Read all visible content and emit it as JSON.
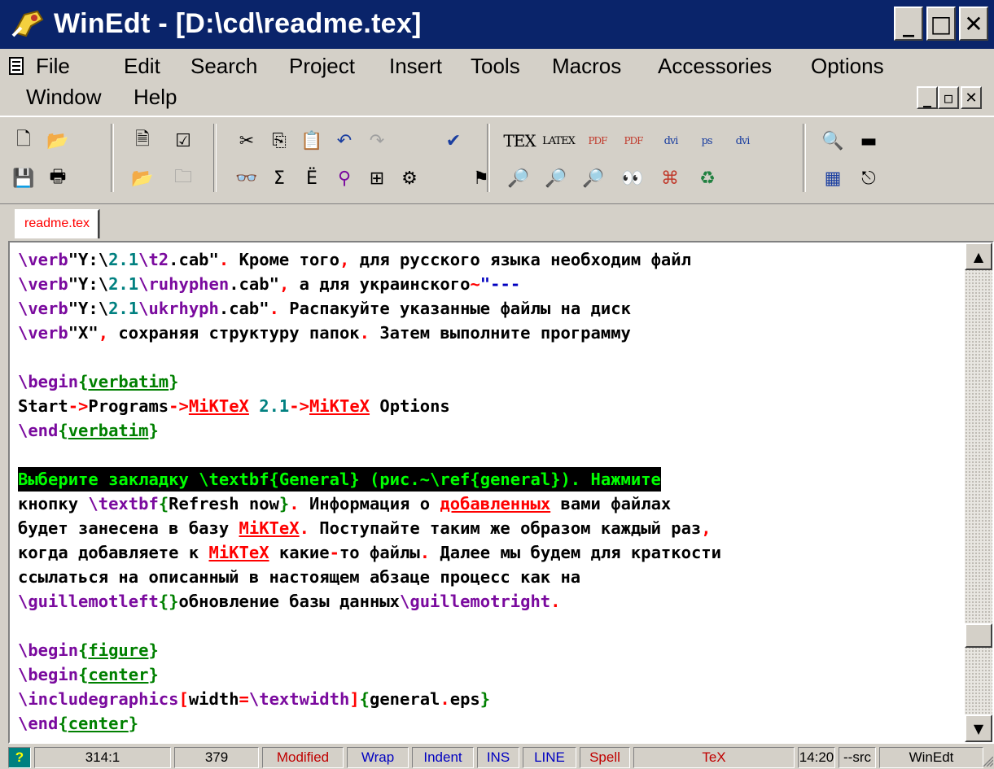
{
  "window": {
    "title": "WinEdt  - [D:\\cd\\readme.tex]",
    "min": "_",
    "max": "□",
    "close": "✕"
  },
  "menu": {
    "row1": [
      "File",
      "Edit",
      "Search",
      "Project",
      "Insert",
      "Tools",
      "Macros",
      "Accessories",
      "Options"
    ],
    "row2": [
      "Window",
      "Help"
    ]
  },
  "toolbar": {
    "row1": [
      {
        "icon": "new-file-icon",
        "glyph": "🗋"
      },
      {
        "icon": "open-file-icon",
        "glyph": "📂"
      },
      {
        "icon": "document-icon",
        "glyph": "🗎"
      },
      {
        "icon": "checklist-icon",
        "glyph": "☑"
      },
      {
        "icon": "cut-icon",
        "glyph": "✂"
      },
      {
        "icon": "copy-icon",
        "glyph": "⎘"
      },
      {
        "icon": "paste-icon",
        "glyph": "📋"
      },
      {
        "icon": "undo-icon",
        "glyph": "↶"
      },
      {
        "icon": "redo-icon",
        "glyph": "↷"
      },
      {
        "icon": "spellcheck-icon",
        "glyph": "✔"
      },
      {
        "icon": "tex-icon",
        "text": "TEX"
      },
      {
        "icon": "latex-icon",
        "text": "LATEX"
      },
      {
        "icon": "pdftex-icon",
        "text": "PDF"
      },
      {
        "icon": "pdflatex-icon",
        "text": "PDF"
      },
      {
        "icon": "dvips-icon",
        "text": "dvi"
      },
      {
        "icon": "ps2pdf-icon",
        "text": "ps"
      },
      {
        "icon": "dvipdf-icon",
        "text": "dvi"
      },
      {
        "icon": "search-icon",
        "glyph": "🔍"
      },
      {
        "icon": "console-icon",
        "glyph": "▬"
      }
    ],
    "row2": [
      {
        "icon": "save-icon",
        "glyph": "💾"
      },
      {
        "icon": "print-icon",
        "glyph": "🖶"
      },
      {
        "icon": "open-project-icon",
        "glyph": "📂"
      },
      {
        "icon": "close-project-icon",
        "glyph": "🗀"
      },
      {
        "icon": "binoculars-icon",
        "glyph": "👓"
      },
      {
        "icon": "sum-icon",
        "glyph": "Σ"
      },
      {
        "icon": "umlaut-icon",
        "glyph": "Ë"
      },
      {
        "icon": "filter-icon",
        "glyph": "⚲"
      },
      {
        "icon": "tree-icon",
        "glyph": "⊞"
      },
      {
        "icon": "macro-icon",
        "glyph": "⚙"
      },
      {
        "icon": "compile-icon",
        "glyph": "⚑"
      },
      {
        "icon": "log-icon",
        "glyph": "🔎"
      },
      {
        "icon": "dvi-preview-icon",
        "glyph": "🔎"
      },
      {
        "icon": "dvi-search-icon",
        "glyph": "🔎"
      },
      {
        "icon": "viewer-icon",
        "glyph": "👀"
      },
      {
        "icon": "acrobat-icon",
        "glyph": "⌘"
      },
      {
        "icon": "cleanup-icon",
        "glyph": "♻"
      },
      {
        "icon": "calculator-icon",
        "glyph": "▦"
      },
      {
        "icon": "exit-icon",
        "glyph": "⎋"
      }
    ]
  },
  "tab": {
    "label": "readme.tex"
  },
  "editor": {
    "lines": [
      [
        [
          "\\verb",
          "cmd"
        ],
        [
          "\"Y:\\",
          ""
        ],
        [
          "2.1",
          "num"
        ],
        [
          "\\t2",
          "cmd"
        ],
        [
          ".cab\"",
          ""
        ],
        [
          ". ",
          "sym"
        ],
        [
          "Кроме того",
          ""
        ],
        [
          ",",
          "sym"
        ],
        [
          " для русского языка необходим файл",
          ""
        ]
      ],
      [
        [
          "\\verb",
          "cmd"
        ],
        [
          "\"Y:\\",
          ""
        ],
        [
          "2.1",
          "num"
        ],
        [
          "\\ruhyphen",
          "cmd"
        ],
        [
          ".cab\"",
          ""
        ],
        [
          ",",
          "sym"
        ],
        [
          " а для украинского",
          ""
        ],
        [
          "~",
          "sym"
        ],
        [
          "\"---",
          "blue"
        ]
      ],
      [
        [
          "\\verb",
          "cmd"
        ],
        [
          "\"Y:\\",
          ""
        ],
        [
          "2.1",
          "num"
        ],
        [
          "\\ukrhyph",
          "cmd"
        ],
        [
          ".cab\"",
          ""
        ],
        [
          ".",
          "sym"
        ],
        [
          " Распакуйте указанные файлы на диск",
          ""
        ]
      ],
      [
        [
          "\\verb",
          "cmd"
        ],
        [
          "\"X\"",
          ""
        ],
        [
          ",",
          "sym"
        ],
        [
          " сохраняя структуру папок",
          ""
        ],
        [
          ".",
          "sym"
        ],
        [
          " Затем выполните программу",
          ""
        ]
      ],
      [],
      [
        [
          "\\begin",
          "cmd"
        ],
        [
          "{",
          "brace"
        ],
        [
          "verbatim",
          "arg"
        ],
        [
          "}",
          "brace"
        ]
      ],
      [
        [
          "Start",
          ""
        ],
        [
          "->",
          "sym"
        ],
        [
          "Programs",
          ""
        ],
        [
          "->",
          "sym"
        ],
        [
          "MiKTeX",
          "kw"
        ],
        [
          " ",
          ""
        ],
        [
          "2.1",
          "num"
        ],
        [
          "->",
          "sym"
        ],
        [
          "MiKTeX",
          "kw"
        ],
        [
          " Options",
          ""
        ]
      ],
      [
        [
          "\\end",
          "cmd"
        ],
        [
          "{",
          "brace"
        ],
        [
          "verbatim",
          "arg"
        ],
        [
          "}",
          "brace"
        ]
      ],
      [],
      [
        [
          "Выберите закладку \\textbf{General} (рис.~\\ref{general}). Нажмите",
          "sel"
        ]
      ],
      [
        [
          "кнопку ",
          ""
        ],
        [
          "\\textbf",
          "cmd"
        ],
        [
          "{",
          "brace"
        ],
        [
          "Refresh now",
          ""
        ],
        [
          "}",
          "brace"
        ],
        [
          ".",
          "sym"
        ],
        [
          " Информация о ",
          ""
        ],
        [
          "добавленных",
          "kw"
        ],
        [
          " вами файлах",
          ""
        ]
      ],
      [
        [
          "будет занесена в базу ",
          ""
        ],
        [
          "MiKTeX",
          "kw"
        ],
        [
          ".",
          "sym"
        ],
        [
          " Поступайте таким же образом каждый раз",
          ""
        ],
        [
          ",",
          "sym"
        ]
      ],
      [
        [
          "когда добавляете к ",
          ""
        ],
        [
          "MiKTeX",
          "kw"
        ],
        [
          " какие",
          ""
        ],
        [
          "-",
          "sym"
        ],
        [
          "то файлы",
          ""
        ],
        [
          ".",
          "sym"
        ],
        [
          " Далее мы будем для краткости",
          ""
        ]
      ],
      [
        [
          "ссылаться на описанный в настоящем абзаце процесс как на",
          ""
        ]
      ],
      [
        [
          "\\guillemotleft",
          "cmd"
        ],
        [
          "{}",
          "brace"
        ],
        [
          "обновление базы данных",
          ""
        ],
        [
          "\\guillemotright",
          "cmd"
        ],
        [
          ".",
          "sym"
        ]
      ],
      [],
      [
        [
          "\\begin",
          "cmd"
        ],
        [
          "{",
          "brace"
        ],
        [
          "figure",
          "arg"
        ],
        [
          "}",
          "brace"
        ]
      ],
      [
        [
          "\\begin",
          "cmd"
        ],
        [
          "{",
          "brace"
        ],
        [
          "center",
          "arg"
        ],
        [
          "}",
          "brace"
        ]
      ],
      [
        [
          "\\includegraphics",
          "cmd"
        ],
        [
          "[",
          "sym"
        ],
        [
          "width",
          ""
        ],
        [
          "=",
          "sym"
        ],
        [
          "\\textwidth",
          "cmd"
        ],
        [
          "]",
          "sym"
        ],
        [
          "{",
          "brace"
        ],
        [
          "general",
          ""
        ],
        [
          ".",
          "sym"
        ],
        [
          "eps",
          ""
        ],
        [
          "}",
          "brace"
        ]
      ],
      [
        [
          "\\end",
          "cmd"
        ],
        [
          "{",
          "brace"
        ],
        [
          "center",
          "arg"
        ],
        [
          "}",
          "brace"
        ]
      ]
    ]
  },
  "scrollbar": {
    "up": "▲",
    "down": "▼"
  },
  "status": {
    "help": "?",
    "position": "314:1",
    "lines": "379",
    "modified": "Modified",
    "wrap": "Wrap",
    "indent": "Indent",
    "ins": "INS",
    "line": "LINE",
    "spell": "Spell",
    "mode": "TeX",
    "time": "14:20",
    "src": "--src",
    "app": "WinEdt"
  },
  "colors": {
    "title_bar": "#0a246a",
    "command": "#7a0a9e",
    "keyword": "#ff0000",
    "argument": "#008000",
    "number": "#008080",
    "selection_bg": "#000000",
    "selection_fg": "#00ff00"
  }
}
